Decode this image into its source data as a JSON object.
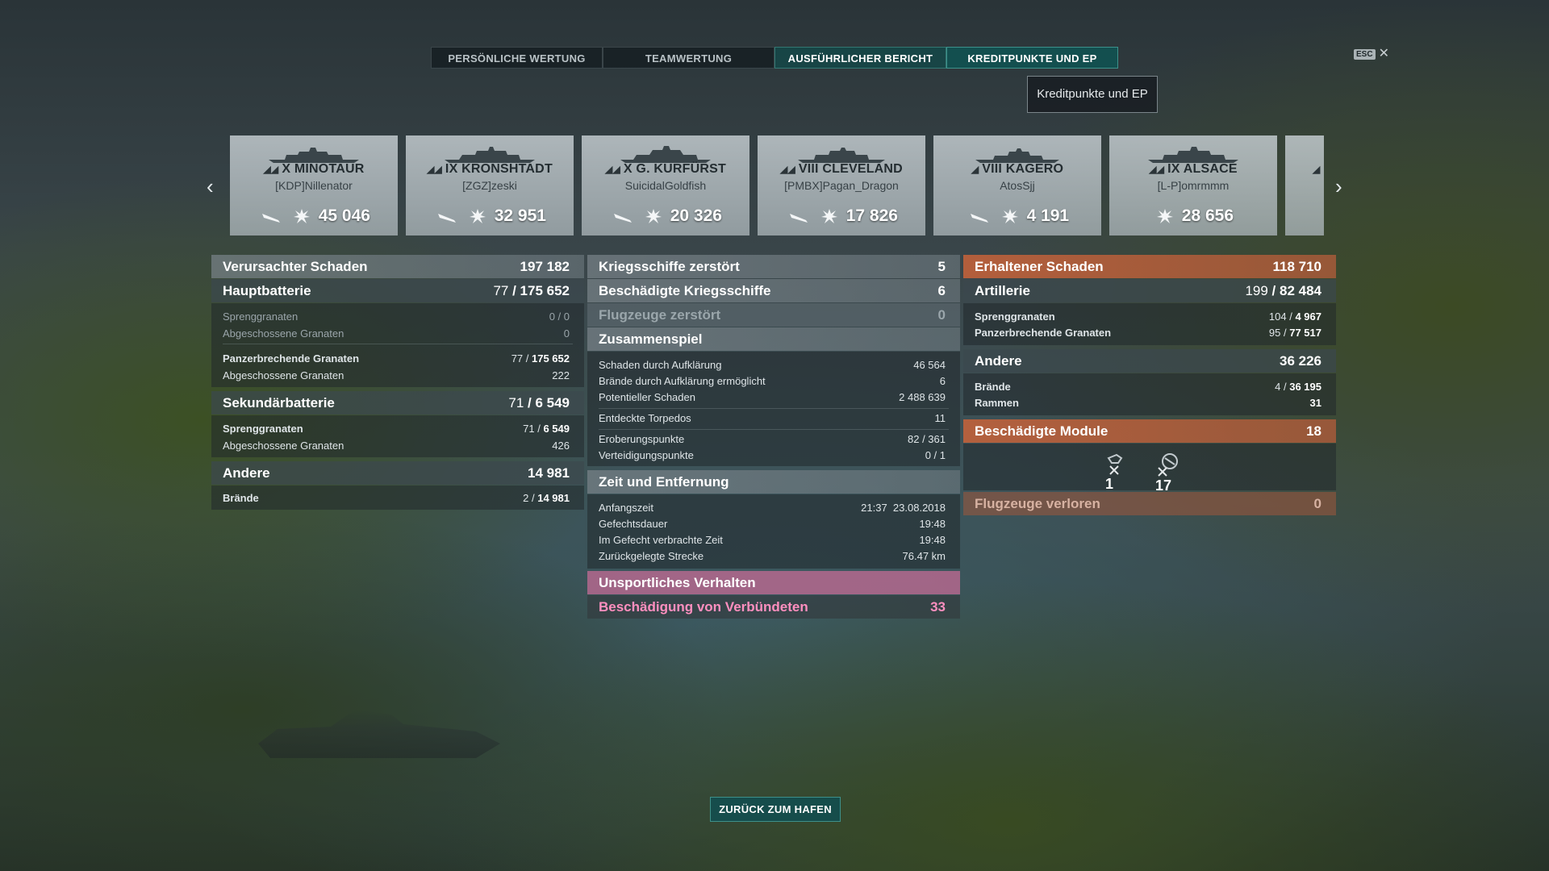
{
  "tabs": [
    {
      "label": "PERSÖNLICHE WERTUNG"
    },
    {
      "label": "TEAMWERTUNG"
    },
    {
      "label": "AUSFÜHRLICHER BERICHT"
    },
    {
      "label": "KREDITPUNKTE UND EP"
    }
  ],
  "tooltip": "Kreditpunkte und EP",
  "esc": "ESC",
  "ships": [
    {
      "tier": "X",
      "name": "MINOTAUR",
      "player": "[KDP]Nillenator",
      "damage": "45 046"
    },
    {
      "tier": "IX",
      "name": "KRONSHTADT",
      "player": "[ZGZ]zeski",
      "damage": "32 951"
    },
    {
      "tier": "X",
      "name": "G. KURFÜRST",
      "player": "SuicidalGoldfish",
      "damage": "20 326"
    },
    {
      "tier": "VIII",
      "name": "CLEVELAND",
      "player": "[PMBX]Pagan_Dragon",
      "damage": "17 826"
    },
    {
      "tier": "VIII",
      "name": "KAGERO",
      "player": "AtosSjj",
      "damage": "4 191"
    },
    {
      "tier": "IX",
      "name": "ALSACE",
      "player": "[L-P]omrmmm",
      "damage": "28 656"
    }
  ],
  "left": {
    "dealt": {
      "label": "Verursachter Schaden",
      "value": "197 182"
    },
    "main_battery": {
      "label": "Hauptbatterie",
      "value_a": "77",
      "value_b": "175 652"
    },
    "he_main": {
      "label": "Sprenggranaten",
      "value": "0 / 0"
    },
    "he_main_fired": {
      "label": "Abgeschossene Granaten",
      "value": "0"
    },
    "ap_main": {
      "label": "Panzerbrechende Granaten",
      "value_a": "77",
      "value_b": "175 652"
    },
    "ap_main_fired": {
      "label": "Abgeschossene Granaten",
      "value": "222"
    },
    "secondary": {
      "label": "Sekundärbatterie",
      "value_a": "71",
      "value_b": "6 549"
    },
    "he_sec": {
      "label": "Sprenggranaten",
      "value_a": "71",
      "value_b": "6 549"
    },
    "he_sec_fired": {
      "label": "Abgeschossene Granaten",
      "value": "426"
    },
    "other": {
      "label": "Andere",
      "value": "14 981"
    },
    "fires": {
      "label": "Brände",
      "value_a": "2",
      "value_b": "14 981"
    }
  },
  "middle": {
    "ships_destroyed": {
      "label": "Kriegsschiffe zerstört",
      "value": "5"
    },
    "ships_damaged": {
      "label": "Beschädigte Kriegsschiffe",
      "value": "6"
    },
    "planes_destroyed": {
      "label": "Flugzeuge zerstört",
      "value": "0"
    },
    "teamplay": {
      "label": "Zusammenspiel"
    },
    "spot_damage": {
      "label": "Schaden durch Aufklärung",
      "value": "46 564"
    },
    "spot_fires": {
      "label": "Brände durch Aufklärung ermöglicht",
      "value": "6"
    },
    "potential": {
      "label": "Potentieller Schaden",
      "value": "2 488 639"
    },
    "torps_spotted": {
      "label": "Entdeckte Torpedos",
      "value": "11"
    },
    "capture": {
      "label": "Eroberungspunkte",
      "value": "82 / 361"
    },
    "defense": {
      "label": "Verteidigungspunkte",
      "value": "0 / 1"
    },
    "time": {
      "label": "Zeit und Entfernung"
    },
    "start": {
      "label": "Anfangszeit",
      "value": "21:37  23.08.2018"
    },
    "duration": {
      "label": "Gefechtsdauer",
      "value": "19:48"
    },
    "alive": {
      "label": "Im Gefecht verbrachte Zeit",
      "value": "19:48"
    },
    "distance": {
      "label": "Zurückgelegte Strecke",
      "value": "76.47 km"
    },
    "unsport": {
      "label": "Unsportliches Verhalten"
    },
    "ally_damage": {
      "label": "Beschädigung von Verbündeten",
      "value": "33"
    }
  },
  "right": {
    "received": {
      "label": "Erhaltener Schaden",
      "value": "118 710"
    },
    "artillery": {
      "label": "Artillerie",
      "value_a": "199",
      "value_b": "82 484"
    },
    "he": {
      "label": "Sprenggranaten",
      "value_a": "104",
      "value_b": "4 967"
    },
    "ap": {
      "label": "Panzerbrechende Granaten",
      "value_a": "95",
      "value_b": "77 517"
    },
    "other": {
      "label": "Andere",
      "value": "36 226"
    },
    "fires": {
      "label": "Brände",
      "value_a": "4",
      "value_b": "36 195"
    },
    "ramming": {
      "label": "Rammen",
      "value": "31"
    },
    "modules": {
      "label": "Beschädigte Module",
      "value": "18"
    },
    "module_a": "1",
    "module_b": "17",
    "planes_lost": {
      "label": "Flugzeuge verloren",
      "value": "0"
    }
  },
  "back_button": "ZURÜCK ZUM HAFEN"
}
